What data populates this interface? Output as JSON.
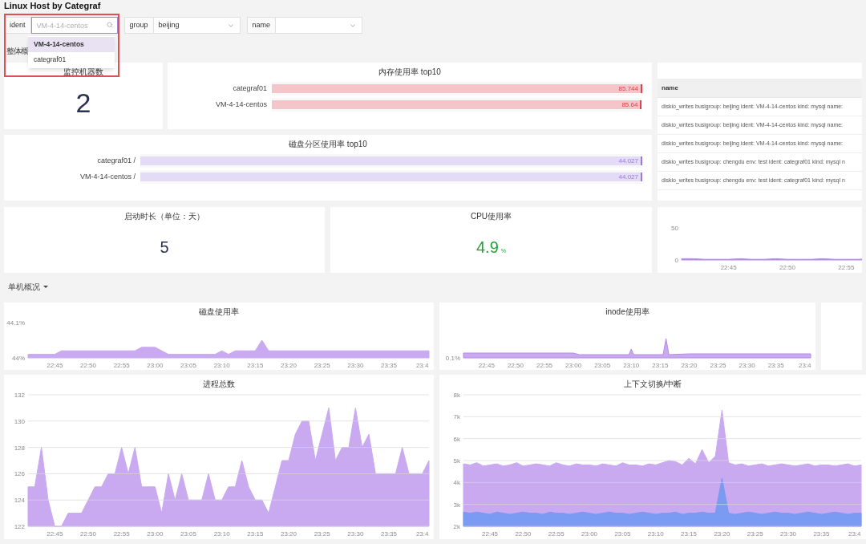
{
  "title": "Linux Host by Categraf",
  "filters": [
    {
      "label": "ident",
      "kind": "search",
      "placeholder": "VM-4-14-centos",
      "focused": true
    },
    {
      "label": "group",
      "kind": "select",
      "value": "beijing"
    },
    {
      "label": "name",
      "kind": "select"
    }
  ],
  "ident_dropdown": {
    "options": [
      {
        "label": "VM-4-14-centos",
        "selected": true
      },
      {
        "label": "categraf01",
        "selected": false
      }
    ]
  },
  "overview_section": {
    "label": "整体概"
  },
  "host_count": {
    "title": "监控机器数",
    "value": "2"
  },
  "memory_top10": {
    "title": "内存使用率 top10",
    "rows": [
      {
        "label": "categraf01",
        "value": "85.744",
        "level": 1
      },
      {
        "label": "VM-4-14-centos",
        "value": "85.64",
        "level": 0.9988
      }
    ]
  },
  "series_table": {
    "columns": [
      "name"
    ],
    "rows": [
      "diskio_writes busigroup: beijing ident: VM-4-14-centos kind: mysql name:",
      "diskio_writes busigroup: beijing ident: VM-4-14-centos kind: mysql name:",
      "diskio_writes busigroup: beijing ident: VM-4-14-centos kind: mysql name:",
      "diskio_writes busigroup: chengdu env: test ident: categraf01 kind: mysql n",
      "diskio_writes busigroup: chengdu env: test ident: categraf01 kind: mysql n"
    ]
  },
  "disk_partition_top10": {
    "title": "磁盘分区使用率 top10",
    "rows": [
      {
        "label": "categraf01 /",
        "value": "44.027",
        "level": 1
      },
      {
        "label": "VM-4-14-centos /",
        "value": "44.027",
        "level": 1
      }
    ]
  },
  "uptime": {
    "title": "启动时长（单位：天）",
    "value": "5"
  },
  "cpu": {
    "title": "CPU使用率",
    "value": "4.9",
    "unit": "%"
  },
  "mini_chart": {
    "chart_data": {
      "type": "area",
      "categories": [
        null,
        null,
        null,
        null,
        "22:45",
        null,
        null,
        null,
        null,
        "22:50",
        null,
        null,
        null,
        null,
        "22:55",
        null,
        null,
        null,
        null
      ],
      "ylim": [
        0,
        50
      ],
      "yticks": [
        0,
        50
      ],
      "series": [
        {
          "color": "#b48be6",
          "values": [
            2,
            2,
            1,
            1,
            1,
            2,
            1,
            1,
            2,
            1,
            1,
            1,
            2,
            1,
            1,
            1,
            2,
            1,
            1
          ]
        }
      ]
    }
  },
  "host_section": {
    "label": "单机概况",
    "expanded": true
  },
  "disk_usage": {
    "title": "磁盘使用率",
    "chart_data": {
      "type": "area",
      "categories": [
        null,
        null,
        null,
        null,
        "22:45",
        null,
        null,
        null,
        null,
        "22:50",
        null,
        null,
        null,
        null,
        "22:55",
        null,
        null,
        null,
        null,
        "23:00",
        null,
        null,
        null,
        null,
        "23:05",
        null,
        null,
        null,
        null,
        "23:10",
        null,
        null,
        null,
        null,
        "23:15",
        null,
        null,
        null,
        null,
        "23:20",
        null,
        null,
        null,
        null,
        "23:25",
        null,
        null,
        null,
        null,
        "23:30",
        null,
        null,
        null,
        null,
        "23:35",
        null,
        null,
        null,
        null,
        "23:4",
        null
      ],
      "ylim": [
        44,
        44.1
      ],
      "yticks": [
        {
          "value": 44,
          "label": "44%"
        },
        {
          "value": 44.1,
          "label": "44.1%"
        }
      ],
      "series": [
        {
          "color": "#c9a9f0",
          "values": [
            44.01,
            44.01,
            44.01,
            44.01,
            44.01,
            44.02,
            44.02,
            44.02,
            44.02,
            44.02,
            44.02,
            44.02,
            44.02,
            44.02,
            44.02,
            44.02,
            44.02,
            44.03,
            44.03,
            44.03,
            44.02,
            44.01,
            44.01,
            44.01,
            44.01,
            44.01,
            44.01,
            44.01,
            44.01,
            44.02,
            44.01,
            44.02,
            44.02,
            44.02,
            44.02,
            44.05,
            44.02,
            44.02,
            44.02,
            44.02,
            44.02,
            44.02,
            44.02,
            44.02,
            44.02,
            44.02,
            44.02,
            44.02,
            44.02,
            44.02,
            44.02,
            44.02,
            44.02,
            44.02,
            44.02,
            44.02,
            44.02,
            44.02,
            44.02,
            44.02,
            44.02
          ]
        }
      ]
    }
  },
  "inode_usage": {
    "title": "inode使用率",
    "ytick_labels": [
      "0.1%"
    ],
    "xtick_labels": [
      "22:45",
      "22:50",
      "22:55",
      "23:00",
      "23:05",
      "23:10",
      "23:15",
      "23:20",
      "23:25",
      "23:30",
      "23:35",
      "23:4"
    ]
  },
  "process_count": {
    "title": "进程总数",
    "chart_data": {
      "type": "area",
      "categories": [
        null,
        null,
        null,
        null,
        "22:45",
        null,
        null,
        null,
        null,
        "22:50",
        null,
        null,
        null,
        null,
        "22:55",
        null,
        null,
        null,
        null,
        "23:00",
        null,
        null,
        null,
        null,
        "23:05",
        null,
        null,
        null,
        null,
        "23:10",
        null,
        null,
        null,
        null,
        "23:15",
        null,
        null,
        null,
        null,
        "23:20",
        null,
        null,
        null,
        null,
        "23:25",
        null,
        null,
        null,
        null,
        "23:30",
        null,
        null,
        null,
        null,
        "23:35",
        null,
        null,
        null,
        null,
        "23:4",
        null
      ],
      "ylim": [
        122,
        132
      ],
      "grid": true,
      "yticks": [
        122,
        124,
        126,
        128,
        130,
        132
      ],
      "series": [
        {
          "color": "#c9a9f0",
          "values": [
            125,
            125,
            128,
            124,
            122,
            122,
            123,
            123,
            123,
            124,
            125,
            125,
            126,
            126,
            128,
            126,
            128,
            125,
            125,
            125,
            123,
            126,
            124,
            126,
            124,
            124,
            124,
            126,
            124,
            124,
            125,
            125,
            127,
            125,
            124,
            124,
            123,
            125,
            127,
            127,
            129,
            130,
            130,
            127,
            129,
            131,
            127,
            128,
            128,
            131,
            128,
            129,
            126,
            126,
            126,
            126,
            128,
            126,
            126,
            126,
            127
          ]
        }
      ]
    }
  },
  "context_switches": {
    "title": "上下文切换/中断",
    "chart_data": {
      "type": "area",
      "categories": [
        null,
        null,
        null,
        null,
        "22:45",
        null,
        null,
        null,
        null,
        "22:50",
        null,
        null,
        null,
        null,
        "22:55",
        null,
        null,
        null,
        null,
        "23:00",
        null,
        null,
        null,
        null,
        "23:05",
        null,
        null,
        null,
        null,
        "23:10",
        null,
        null,
        null,
        null,
        "23:15",
        null,
        null,
        null,
        null,
        "23:20",
        null,
        null,
        null,
        null,
        "23:25",
        null,
        null,
        null,
        null,
        "23:30",
        null,
        null,
        null,
        null,
        "23:35",
        null,
        null,
        null,
        null,
        "23:4",
        null
      ],
      "ylim": [
        2000,
        8000
      ],
      "grid": true,
      "yticks": [
        {
          "value": 2000,
          "label": "2k"
        },
        {
          "value": 3000,
          "label": "3k"
        },
        {
          "value": 4000,
          "label": "4k"
        },
        {
          "value": 5000,
          "label": "5k"
        },
        {
          "value": 6000,
          "label": "6k"
        },
        {
          "value": 7000,
          "label": "7k"
        },
        {
          "value": 8000,
          "label": "8k"
        }
      ],
      "series": [
        {
          "color": "#c9a9f0",
          "values": [
            4850,
            4800,
            4900,
            4750,
            4800,
            4850,
            4750,
            4800,
            4900,
            4750,
            4800,
            4850,
            4800,
            4750,
            4900,
            4800,
            4750,
            4850,
            4800,
            4800,
            4750,
            4850,
            4800,
            4750,
            4900,
            4800,
            4800,
            4750,
            4850,
            4800,
            4900,
            5000,
            4950,
            4800,
            5100,
            4850,
            5500,
            4900,
            5200,
            7300,
            4900,
            4800,
            4850,
            4750,
            4800,
            4850,
            4750,
            4800,
            4850,
            4800,
            4750,
            4800,
            4850,
            4750,
            4800,
            4800,
            4750,
            4800,
            4850,
            4750,
            4800
          ]
        },
        {
          "color": "#7b9af2",
          "values": [
            2650,
            2600,
            2650,
            2600,
            2550,
            2650,
            2600,
            2550,
            2600,
            2650,
            2600,
            2600,
            2550,
            2650,
            2600,
            2600,
            2550,
            2600,
            2650,
            2600,
            2550,
            2600,
            2650,
            2600,
            2600,
            2550,
            2600,
            2650,
            2600,
            2550,
            2600,
            2600,
            2650,
            2550,
            2600,
            2600,
            2650,
            2600,
            2600,
            4200,
            2600,
            2550,
            2600,
            2650,
            2600,
            2550,
            2600,
            2650,
            2600,
            2600,
            2550,
            2600,
            2650,
            2600,
            2550,
            2600,
            2650,
            2600,
            2550,
            2600,
            2600
          ]
        }
      ]
    }
  }
}
